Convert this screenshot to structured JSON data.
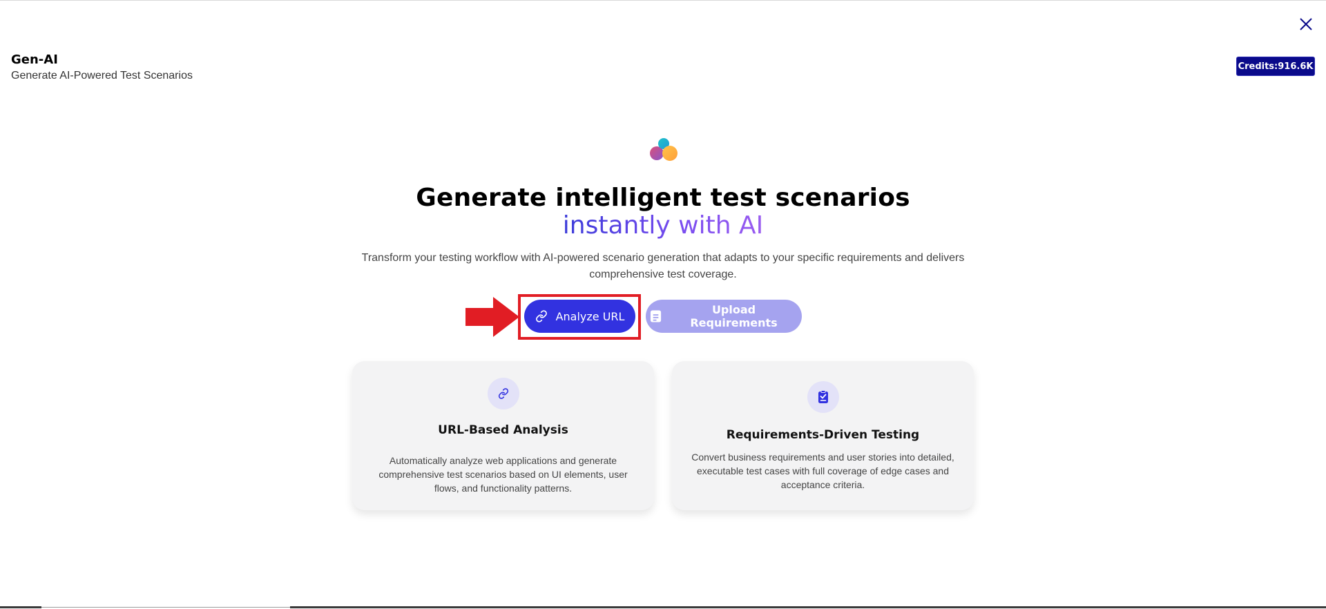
{
  "header": {
    "title": "Gen-AI",
    "subtitle": "Generate AI-Powered Test Scenarios"
  },
  "credits": {
    "label": "Credits:916.6K"
  },
  "hero": {
    "title": "Generate intelligent test scenarios",
    "subtitle": "instantly with AI",
    "description_line1": "Transform your testing workflow with AI-powered scenario generation that adapts to your specific requirements and delivers",
    "description_line2": "comprehensive test coverage."
  },
  "buttons": {
    "analyze_url": "Analyze URL",
    "upload_requirements": "Upload Requirements"
  },
  "cards": [
    {
      "title": "URL-Based Analysis",
      "text": "Automatically analyze web applications and generate comprehensive test scenarios based on UI elements, user flows, and functionality patterns.",
      "icon": "link-icon"
    },
    {
      "title": "Requirements-Driven Testing",
      "text": "Convert business requirements and user stories into detailed, executable test cases with full coverage of edge cases and acceptance criteria.",
      "icon": "clipboard-check-icon"
    }
  ],
  "colors": {
    "primary": "#3232e0",
    "primary_light": "#a5a3ef",
    "credits_bg": "#0a0a8a",
    "highlight": "#e11d24",
    "card_bg": "#f3f3f4"
  }
}
